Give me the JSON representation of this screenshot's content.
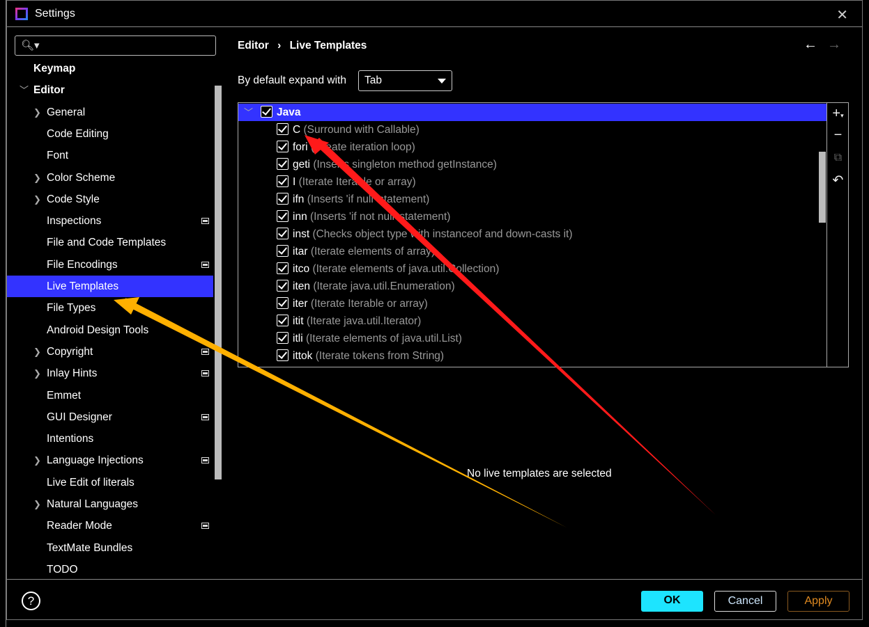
{
  "window": {
    "title": "Settings"
  },
  "search": {
    "placeholder": ""
  },
  "sidebar": {
    "items": [
      {
        "label": "Keymap",
        "level": 0,
        "bold": true
      },
      {
        "label": "Editor",
        "level": 0,
        "bold": true,
        "expanded": true
      },
      {
        "label": "General",
        "level": 1,
        "chevron": true
      },
      {
        "label": "Code Editing",
        "level": 1
      },
      {
        "label": "Font",
        "level": 1
      },
      {
        "label": "Color Scheme",
        "level": 1,
        "chevron": true
      },
      {
        "label": "Code Style",
        "level": 1,
        "chevron": true
      },
      {
        "label": "Inspections",
        "level": 1,
        "marker": true
      },
      {
        "label": "File and Code Templates",
        "level": 1
      },
      {
        "label": "File Encodings",
        "level": 1,
        "marker": true
      },
      {
        "label": "Live Templates",
        "level": 1,
        "selected": true
      },
      {
        "label": "File Types",
        "level": 1
      },
      {
        "label": "Android Design Tools",
        "level": 1
      },
      {
        "label": "Copyright",
        "level": 1,
        "chevron": true,
        "marker": true
      },
      {
        "label": "Inlay Hints",
        "level": 1,
        "chevron": true,
        "marker": true
      },
      {
        "label": "Emmet",
        "level": 1
      },
      {
        "label": "GUI Designer",
        "level": 1,
        "marker": true
      },
      {
        "label": "Intentions",
        "level": 1
      },
      {
        "label": "Language Injections",
        "level": 1,
        "chevron": true,
        "marker": true
      },
      {
        "label": "Live Edit of literals",
        "level": 1
      },
      {
        "label": "Natural Languages",
        "level": 1,
        "chevron": true
      },
      {
        "label": "Reader Mode",
        "level": 1,
        "marker": true
      },
      {
        "label": "TextMate Bundles",
        "level": 1
      },
      {
        "label": "TODO",
        "level": 1
      }
    ]
  },
  "breadcrumb": {
    "parent": "Editor",
    "separator": "›",
    "current": "Live Templates"
  },
  "expand": {
    "label": "By default expand with",
    "value": "Tab"
  },
  "templates": {
    "group": "Java",
    "group_checked": true,
    "items": [
      {
        "abbr": "C",
        "desc": "(Surround with Callable)",
        "checked": true
      },
      {
        "abbr": "fori",
        "desc": "(Create iteration loop)",
        "checked": true
      },
      {
        "abbr": "geti",
        "desc": "(Inserts singleton method getInstance)",
        "checked": true
      },
      {
        "abbr": "I",
        "desc": "(Iterate Iterable or array)",
        "checked": true
      },
      {
        "abbr": "ifn",
        "desc": "(Inserts 'if null' statement)",
        "checked": true
      },
      {
        "abbr": "inn",
        "desc": "(Inserts 'if not null' statement)",
        "checked": true
      },
      {
        "abbr": "inst",
        "desc": "(Checks object type with instanceof and down-casts it)",
        "checked": true
      },
      {
        "abbr": "itar",
        "desc": "(Iterate elements of array)",
        "checked": true
      },
      {
        "abbr": "itco",
        "desc": "(Iterate elements of java.util.Collection)",
        "checked": true
      },
      {
        "abbr": "iten",
        "desc": "(Iterate java.util.Enumeration)",
        "checked": true
      },
      {
        "abbr": "iter",
        "desc": "(Iterate Iterable or array)",
        "checked": true
      },
      {
        "abbr": "itit",
        "desc": "(Iterate java.util.Iterator)",
        "checked": true
      },
      {
        "abbr": "itli",
        "desc": "(Iterate elements of java.util.List)",
        "checked": true
      },
      {
        "abbr": "ittok",
        "desc": "(Iterate tokens from String)",
        "checked": true
      }
    ]
  },
  "empty_message": "No live templates are selected",
  "footer": {
    "help": "?",
    "ok": "OK",
    "cancel": "Cancel",
    "apply": "Apply"
  },
  "colors": {
    "selection": "#3333ff",
    "ok": "#1de4ff",
    "apply": "#e08a20",
    "annotation_red": "#ff1a1a",
    "annotation_orange": "#ffb000"
  }
}
